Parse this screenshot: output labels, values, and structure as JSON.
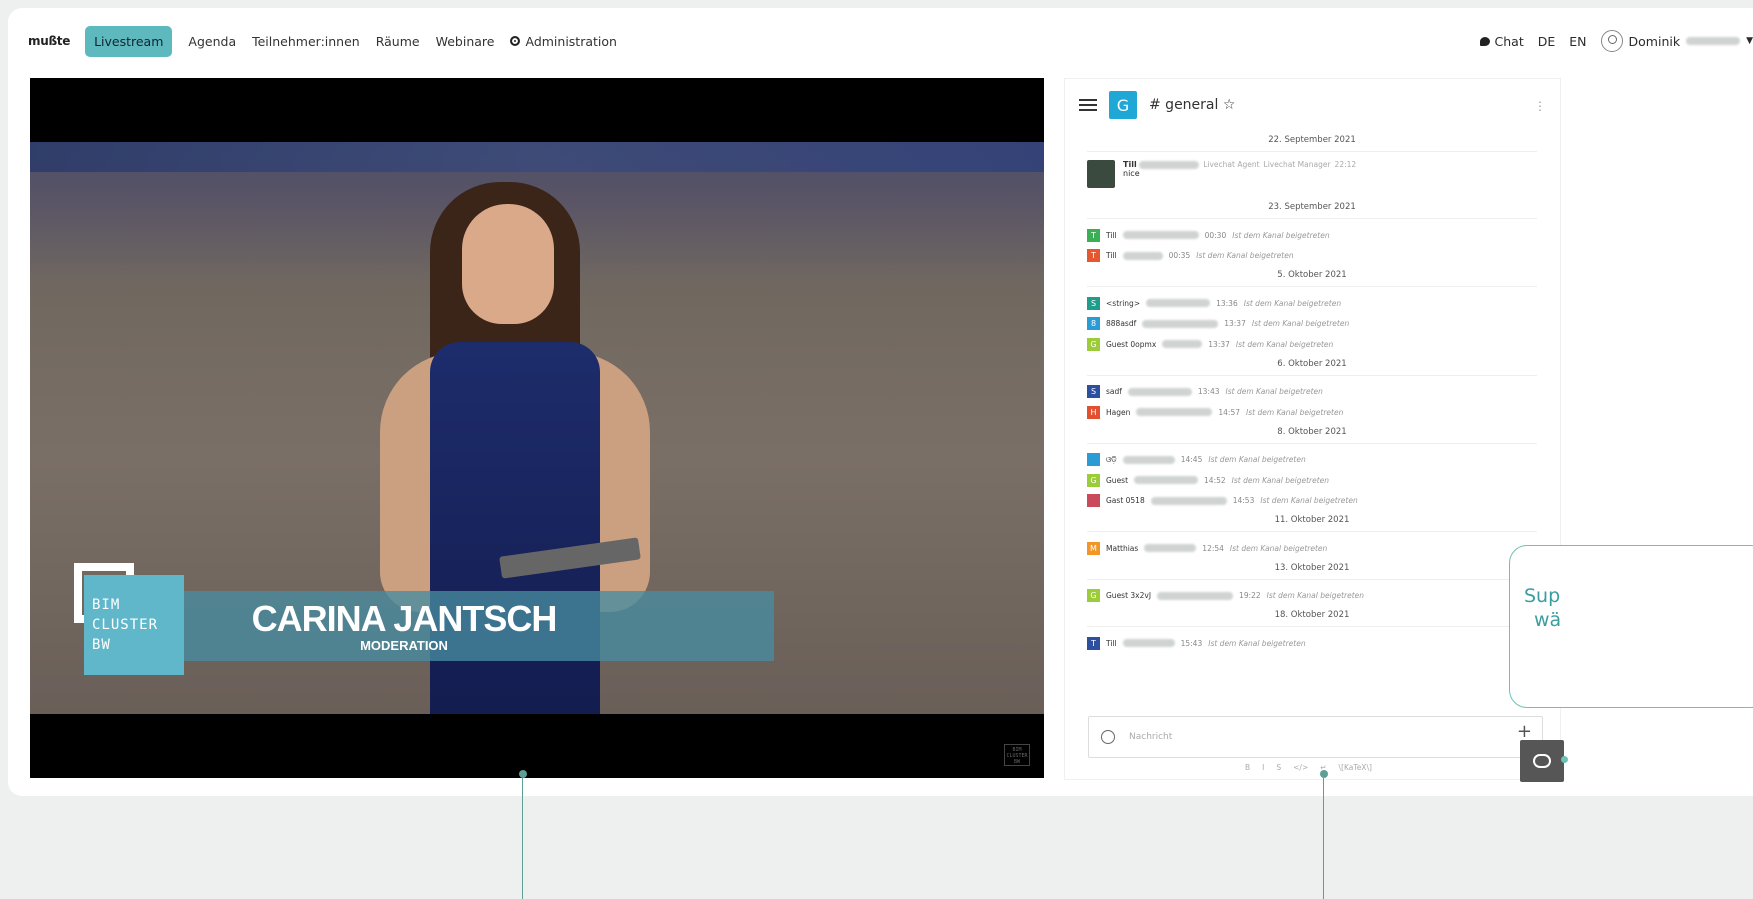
{
  "topbar": {
    "logo": "mußte",
    "nav": [
      "Livestream",
      "Agenda",
      "Teilnehmer:innen",
      "Räume",
      "Webinare",
      "Administration"
    ],
    "chat_label": "Chat",
    "lang_de": "DE",
    "lang_en": "EN",
    "user_name": "Dominik"
  },
  "video": {
    "lower_third_logo": [
      "BIM",
      "CLUSTER",
      "BW"
    ],
    "speaker_name": "CARINA JANTSCH",
    "speaker_role": "MODERATION"
  },
  "chat": {
    "room_initial": "G",
    "room_name": "# general ☆",
    "messages": [
      {
        "date": "22. September 2021"
      },
      {
        "name": "Till",
        "badges": [
          "Livechat Agent",
          "Livechat Manager"
        ],
        "time": "22:12",
        "text": "nice"
      },
      {
        "date": "23. September 2021"
      },
      {
        "initial": "T",
        "color": "#3cae56",
        "name": "Till",
        "time": "00:30",
        "text": "Ist dem Kanal beigetreten"
      },
      {
        "initial": "T",
        "color": "#e5572f",
        "name": "Till",
        "time": "00:35",
        "text": "Ist dem Kanal beigetreten"
      },
      {
        "date": "5. Oktober 2021"
      },
      {
        "initial": "S",
        "color": "#1f9d8a",
        "name": "<string>",
        "time": "13:36",
        "text": "Ist dem Kanal beigetreten"
      },
      {
        "initial": "8",
        "color": "#2b9bd6",
        "name": "888asdf",
        "time": "13:37",
        "text": "Ist dem Kanal beigetreten"
      },
      {
        "initial": "G",
        "color": "#9ccc3a",
        "name": "Guest 0opmx",
        "time": "13:37",
        "text": "Ist dem Kanal beigetreten"
      },
      {
        "date": "6. Oktober 2021"
      },
      {
        "initial": "S",
        "color": "#2d4fa0",
        "name": "sadf",
        "time": "13:43",
        "text": "Ist dem Kanal beigetreten"
      },
      {
        "initial": "H",
        "color": "#e2502f",
        "name": "Hagen",
        "time": "14:57",
        "text": "Ist dem Kanal beigetreten"
      },
      {
        "date": "8. Oktober 2021"
      },
      {
        "initial": "",
        "color": "#2b9bd6",
        "name": "ଓଡ଼ି",
        "time": "14:45",
        "text": "Ist dem Kanal beigetreten"
      },
      {
        "initial": "G",
        "color": "#9ccc3a",
        "name": "Guest",
        "time": "14:52",
        "text": "Ist dem Kanal beigetreten"
      },
      {
        "initial": "",
        "color": "#c94a5a",
        "name": "Gast 0518",
        "time": "14:53",
        "text": "Ist dem Kanal beigetreten"
      },
      {
        "date": "11. Oktober 2021"
      },
      {
        "initial": "M",
        "color": "#f29727",
        "name": "Matthias",
        "time": "12:54",
        "text": "Ist dem Kanal beigetreten"
      },
      {
        "date": "13. Oktober 2021"
      },
      {
        "initial": "G",
        "color": "#9ccc3a",
        "name": "Guest 3x2vJ",
        "time": "19:22",
        "text": "Ist dem Kanal beigetreten"
      },
      {
        "date": "18. Oktober 2021"
      },
      {
        "initial": "T",
        "color": "#2d4fa0",
        "name": "Till",
        "time": "15:43",
        "text": "Ist dem Kanal beigetreten"
      }
    ],
    "composer_placeholder": "Nachricht",
    "toolbar": [
      "B",
      "I",
      "S",
      "</>",
      "↵",
      "\\[KaTeX\\]"
    ]
  },
  "support": {
    "line1": "Sup",
    "line2": "wä"
  }
}
